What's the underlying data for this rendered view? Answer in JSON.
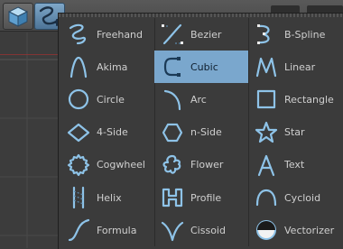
{
  "menu": {
    "columns": [
      [
        {
          "label": "Freehand",
          "icon": "freehand-icon"
        },
        {
          "label": "Akima",
          "icon": "akima-icon"
        },
        {
          "label": "Circle",
          "icon": "circle-icon"
        },
        {
          "label": "4-Side",
          "icon": "four-side-icon"
        },
        {
          "label": "Cogwheel",
          "icon": "cogwheel-icon"
        },
        {
          "label": "Helix",
          "icon": "helix-icon"
        },
        {
          "label": "Formula",
          "icon": "formula-icon"
        }
      ],
      [
        {
          "label": "Bezier",
          "icon": "bezier-icon"
        },
        {
          "label": "Cubic",
          "icon": "cubic-icon",
          "selected": true
        },
        {
          "label": "Arc",
          "icon": "arc-icon"
        },
        {
          "label": "n-Side",
          "icon": "n-side-icon"
        },
        {
          "label": "Flower",
          "icon": "flower-icon"
        },
        {
          "label": "Profile",
          "icon": "profile-icon"
        },
        {
          "label": "Cissoid",
          "icon": "cissoid-icon"
        }
      ],
      [
        {
          "label": "B-Spline",
          "icon": "b-spline-icon"
        },
        {
          "label": "Linear",
          "icon": "linear-icon"
        },
        {
          "label": "Rectangle",
          "icon": "rectangle-icon"
        },
        {
          "label": "Star",
          "icon": "star-icon"
        },
        {
          "label": "Text",
          "icon": "text-icon"
        },
        {
          "label": "Cycloid",
          "icon": "cycloid-icon"
        },
        {
          "label": "Vectorizer",
          "icon": "vectorizer-icon"
        }
      ]
    ]
  },
  "colors": {
    "selected_bg": "#7aa7cd",
    "icon_stroke": "#8ec3e8",
    "menu_bg": "#3b3b3b"
  }
}
